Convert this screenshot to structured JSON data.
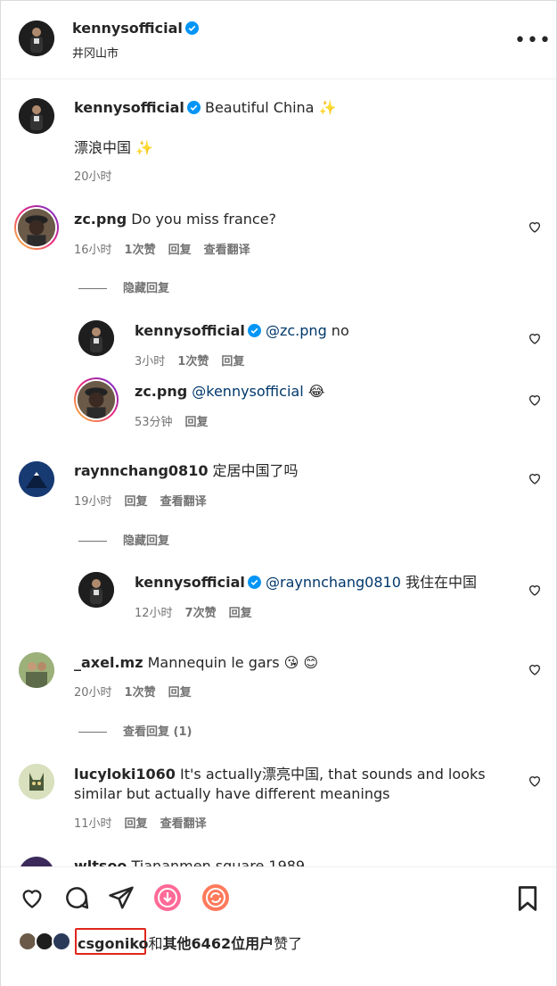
{
  "header": {
    "username": "kennysofficial",
    "location": "井冈山市",
    "more_icon": "more-horizontal-icon"
  },
  "caption": {
    "username": "kennysofficial",
    "text": "Beautiful China ✨",
    "body": "漂浪中国 ✨",
    "time": "20小时"
  },
  "comments": [
    {
      "username": "zc.png",
      "text": "Do you miss france?",
      "time": "16小时",
      "likes": "1次赞",
      "reply": "回复",
      "translate": "查看翻译",
      "hide_replies": "隐藏回复",
      "replies": [
        {
          "username": "kennysofficial",
          "mention": "@zc.png",
          "text": " no",
          "time": "3小时",
          "likes": "1次赞",
          "reply": "回复"
        },
        {
          "username": "zc.png",
          "mention": "@kennysofficial",
          "text": " 😂",
          "time": "53分钟",
          "reply": "回复"
        }
      ]
    },
    {
      "username": "raynnchang0810",
      "text": "定居中国了吗",
      "time": "19小时",
      "reply": "回复",
      "translate": "查看翻译",
      "hide_replies": "隐藏回复",
      "replies": [
        {
          "username": "kennysofficial",
          "mention": "@raynnchang0810",
          "text": " 我住在中国",
          "time": "12小时",
          "likes": "7次赞",
          "reply": "回复"
        }
      ]
    },
    {
      "username": "_axel.mz",
      "text": "Mannequin le gars 😘 😊",
      "time": "20小时",
      "likes": "1次赞",
      "reply": "回复",
      "view_replies": "查看回复 (1)"
    },
    {
      "username": "lucyloki1060",
      "text": "It's actually漂亮中国, that sounds and looks",
      "text2": "similar but actually have different meanings",
      "time": "11小时",
      "reply": "回复",
      "translate": "查看翻译"
    },
    {
      "username": "wltsoo",
      "text": "Tiananmen square 1989"
    }
  ],
  "actions": {
    "like_icon": "heart-icon",
    "comment_icon": "comment-icon",
    "share_icon": "send-icon",
    "download_icon": "download-icon",
    "repost_icon": "repost-icon",
    "save_icon": "bookmark-icon"
  },
  "likes_line": {
    "user": "csgoniko",
    "connector": "和",
    "others": "其他6462位用户",
    "suffix": "赞了"
  },
  "colors": {
    "verified": "#0095f6",
    "highlight_box": "#e0261b",
    "story_ring_start": "#f9ce34",
    "story_ring_end": "#6228d7",
    "download_badge": "#ff4f8b"
  }
}
